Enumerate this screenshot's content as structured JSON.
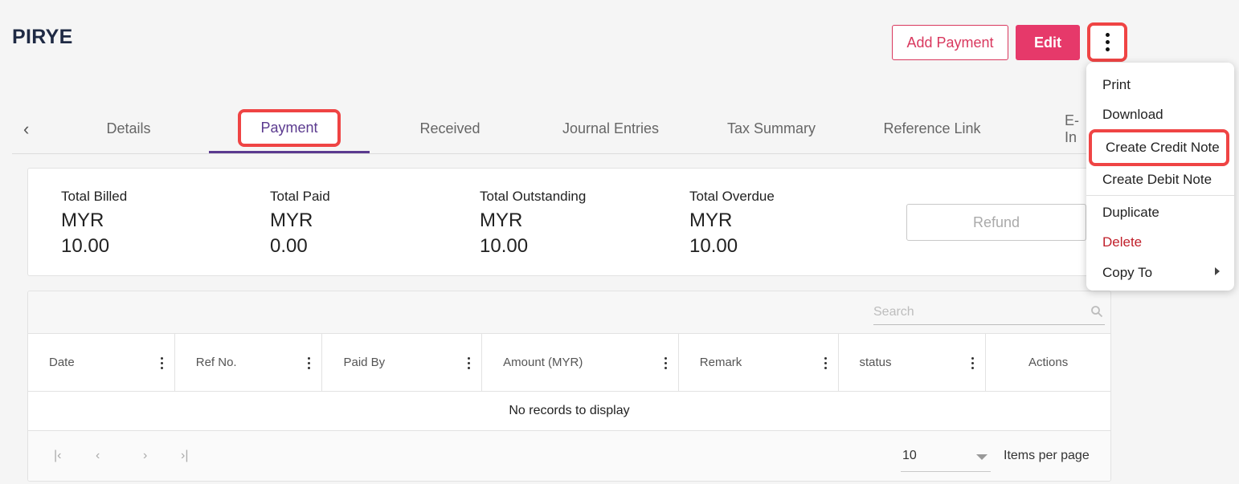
{
  "page": {
    "title": "PIRYE"
  },
  "header": {
    "add_payment_label": "Add Payment",
    "edit_label": "Edit",
    "more_icon": "more-vertical-icon"
  },
  "tabs": [
    {
      "label": "Details",
      "active": false
    },
    {
      "label": "Payment",
      "active": true
    },
    {
      "label": "Received",
      "active": false
    },
    {
      "label": "Journal Entries",
      "active": false
    },
    {
      "label": "Tax Summary",
      "active": false
    },
    {
      "label": "Reference Link",
      "active": false
    },
    {
      "label": "E-In",
      "active": false
    }
  ],
  "summary": {
    "items": [
      {
        "label": "Total Billed",
        "currency": "MYR",
        "amount": "10.00"
      },
      {
        "label": "Total Paid",
        "currency": "MYR",
        "amount": "0.00"
      },
      {
        "label": "Total Outstanding",
        "currency": "MYR",
        "amount": "10.00"
      },
      {
        "label": "Total Overdue",
        "currency": "MYR",
        "amount": "10.00"
      }
    ],
    "refund_label": "Refund"
  },
  "grid": {
    "search_placeholder": "Search",
    "columns": [
      "Date",
      "Ref No.",
      "Paid By",
      "Amount (MYR)",
      "Remark",
      "status",
      "Actions"
    ],
    "empty_message": "No records to display",
    "page_size": "10",
    "items_per_page_label": "Items per page"
  },
  "menu": {
    "items": [
      {
        "label": "Print"
      },
      {
        "label": "Download"
      },
      {
        "label": "Create Credit Note",
        "highlighted": true
      },
      {
        "label": "Create Debit Note"
      },
      {
        "label": "Duplicate"
      },
      {
        "label": "Delete",
        "color": "#c0202b"
      },
      {
        "label": "Copy To",
        "submenu": true
      }
    ]
  },
  "colors": {
    "accent": "#e6396a",
    "tab_active": "#5b3a8f",
    "highlight": "#ef4444"
  }
}
